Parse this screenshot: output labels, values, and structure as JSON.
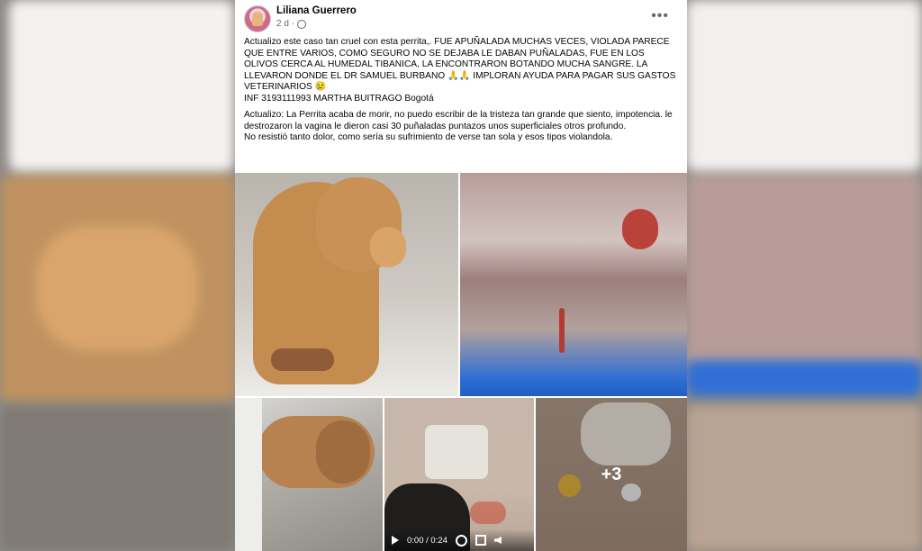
{
  "post": {
    "author": "Liliana Guerrero",
    "time": "2 d",
    "paragraphs": [
      "Actualizo este caso tan cruel con esta perrita,. FUE APUÑALADA MUCHAS VECES, VIOLADA PARECE QUE ENTRE VARIOS, COMO SEGURO NO SE DEJABA LE DABAN PUÑALADAS, FUE EN LOS OLIVOS CERCA AL HUMEDAL TIBANICA, LA ENCONTRARON BOTANDO MUCHA SANGRE. LA LLEVARON DONDE EL DR SAMUEL BURBANO 🙏🙏 IMPLORAN AYUDA PARA PAGAR SUS GASTOS VETERINARIOS 😢\nINF 3193111993 MARTHA BUITRAGO Bogotá",
      "Actualizo: La Perrita acaba de morir, no puedo escribir de la tristeza tan grande que siento, impotencia. le destrozaron la vagina le dieron casi 30 puñaladas puntazos unos superficiales otros profundo.\nNo resistió tanto dolor, como sería su sufrimiento de verse tan sola y esos tipos violandola."
    ],
    "more_photos": "+3",
    "video_time": "0:00 / 0:24"
  },
  "icons": {
    "more": "more-options-icon",
    "audience": "globe-icon",
    "play": "play-icon",
    "settings": "gear-icon",
    "fullscreen": "expand-icon",
    "volume": "mute-icon"
  }
}
